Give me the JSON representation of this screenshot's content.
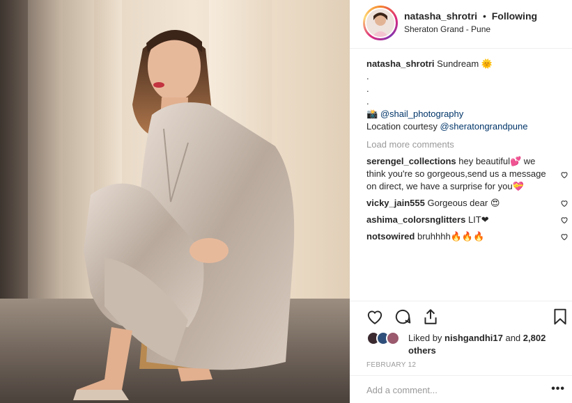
{
  "header": {
    "username": "natasha_shrotri",
    "separator": "•",
    "follow_status": "Following",
    "location": "Sheraton Grand - Pune"
  },
  "caption": {
    "username": "natasha_shrotri",
    "text": "Sundream 🌞",
    "dots": [
      ".",
      ".",
      "."
    ],
    "credit_emoji": "📸",
    "credit_handle": "@shail_photography",
    "location_prefix": "Location courtesy",
    "location_handle": "@sheratongrandpune"
  },
  "load_more": "Load more comments",
  "comments": [
    {
      "user": "serengel_collections",
      "text": "hey beautiful💕 we think you're so gorgeous,send us a message on direct, we have a surprise for you💝"
    },
    {
      "user": "vicky_jain555",
      "text": "Gorgeous dear 😍"
    },
    {
      "user": "ashima_colorsnglitters",
      "text": "LIT❤"
    },
    {
      "user": "notsowired",
      "text": "bruhhhh🔥🔥🔥"
    }
  ],
  "likes": {
    "prefix": "Liked by",
    "user": "nishgandhi17",
    "middle": "and",
    "others": "2,802 others"
  },
  "date": "FEBRUARY 12",
  "add_comment": {
    "placeholder": "Add a comment..."
  },
  "more_label": "•••",
  "colors": {
    "link": "#003569",
    "muted": "#999999",
    "text": "#262626"
  }
}
